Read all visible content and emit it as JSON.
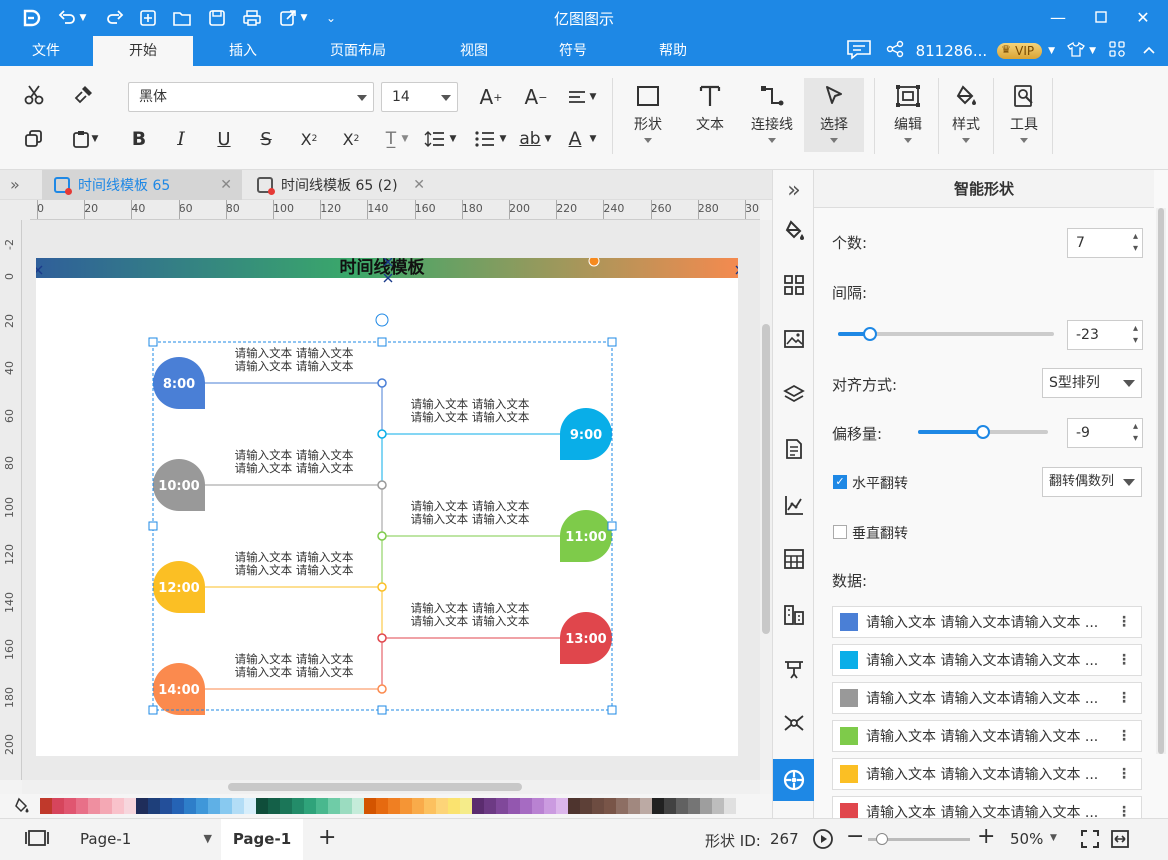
{
  "app": {
    "title": "亿图图示",
    "user_id": "811286...",
    "vip": "VIP"
  },
  "menu": [
    {
      "label": "文件"
    },
    {
      "label": "开始"
    },
    {
      "label": "插入"
    },
    {
      "label": "页面布局"
    },
    {
      "label": "视图"
    },
    {
      "label": "符号"
    },
    {
      "label": "帮助"
    }
  ],
  "ribbon": {
    "font_family": "黑体",
    "font_size": "14",
    "big_buttons": [
      {
        "label": "形状",
        "icon": "rectangle-icon"
      },
      {
        "label": "文本",
        "icon": "text-icon"
      },
      {
        "label": "连接线",
        "icon": "connector-icon"
      },
      {
        "label": "选择",
        "icon": "cursor-icon"
      },
      {
        "label": "编辑",
        "icon": "edit-icon"
      },
      {
        "label": "样式",
        "icon": "paint-bucket-icon"
      },
      {
        "label": "工具",
        "icon": "tools-icon"
      }
    ]
  },
  "tabs": [
    {
      "label": "时间线模板 65"
    },
    {
      "label": "时间线模板 65 (2)"
    }
  ],
  "ruler": {
    "h": [
      "0",
      "20",
      "40",
      "60",
      "80",
      "100",
      "120",
      "140",
      "160",
      "180",
      "200",
      "220",
      "240",
      "260",
      "280",
      "30"
    ],
    "v": [
      "-2",
      "0",
      "20",
      "40",
      "60",
      "80",
      "100",
      "120",
      "140",
      "160",
      "180",
      "200"
    ]
  },
  "diagram": {
    "title": "时间线模板",
    "item_text_line": "请输入文本 请输入文本",
    "times": [
      "8:00",
      "9:00",
      "10:00",
      "11:00",
      "12:00",
      "13:00",
      "14:00"
    ],
    "colors": [
      "#4a7fd6",
      "#09aee8",
      "#999999",
      "#7ecb4a",
      "#fbbf24",
      "#e0464c",
      "#fb8a4e"
    ]
  },
  "panel": {
    "title": "智能形状",
    "count_label": "个数:",
    "count_value": "7",
    "gap_label": "间隔:",
    "gap_value": "-23",
    "gap_level": 0.15,
    "align_label": "对齐方式:",
    "align_value": "S型排列",
    "offset_label": "偏移量:",
    "offset_value": "-9",
    "offset_level": 0.5,
    "hflip_label": "水平翻转",
    "hflip_checked": true,
    "hflip_option": "翻转偶数列",
    "vflip_label": "垂直翻转",
    "vflip_checked": false,
    "data_label": "数据:",
    "rows": [
      {
        "text": "请输入文本 请输入文本请输入文本 ...",
        "color": "#4a7fd6"
      },
      {
        "text": "请输入文本 请输入文本请输入文本 ...",
        "color": "#09aee8"
      },
      {
        "text": "请输入文本 请输入文本请输入文本 ...",
        "color": "#999999"
      },
      {
        "text": "请输入文本 请输入文本请输入文本 ...",
        "color": "#7ecb4a"
      },
      {
        "text": "请输入文本 请输入文本请输入文本 ...",
        "color": "#fbbf24"
      },
      {
        "text": "请输入文本 请输入文本请输入文本 ...",
        "color": "#e0464c"
      }
    ]
  },
  "status": {
    "page_select": "Page-1",
    "page_tab": "Page-1",
    "shape_id_label": "形状 ID:",
    "shape_id": "267",
    "zoom": "50%"
  }
}
